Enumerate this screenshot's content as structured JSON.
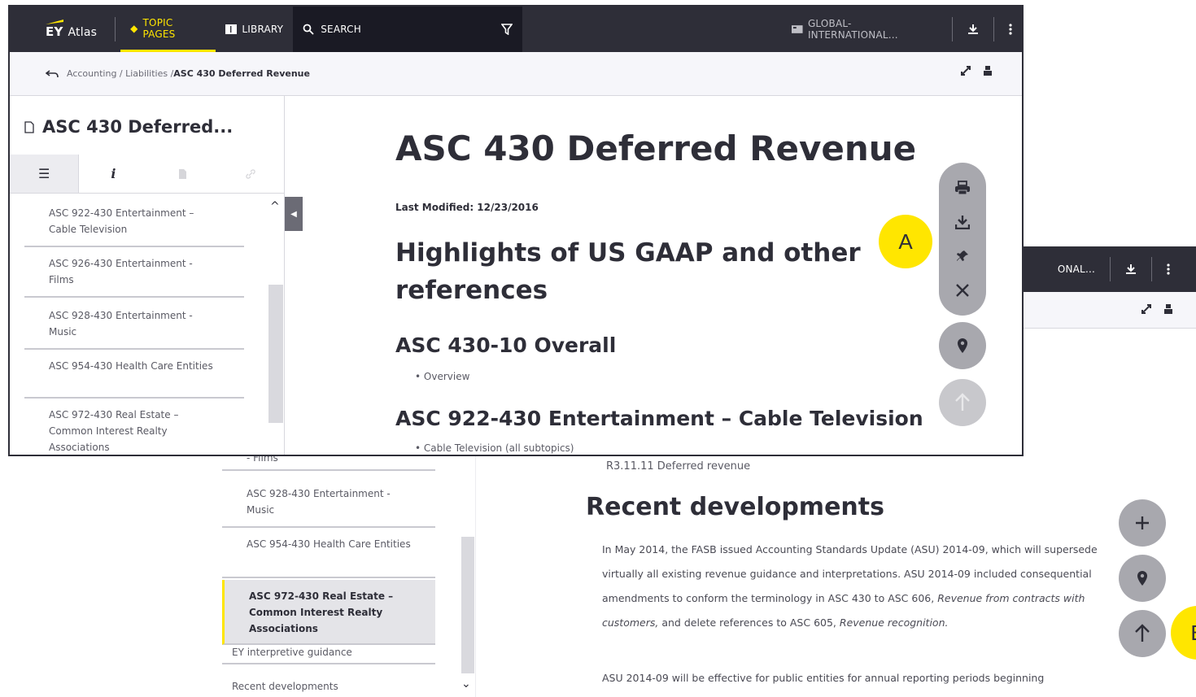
{
  "back": {
    "topbar": {
      "region": "ONAL...",
      "download_icon": "download-icon",
      "menu_icon": "more-vert-icon"
    },
    "sidebar": {
      "items": [
        {
          "label": "- Films"
        },
        {
          "label": "ASC 928-430 Entertainment - Music"
        },
        {
          "label": "ASC 954-430 Health Care Entities"
        },
        {
          "label": "ASC 972-430 Real Estate – Common Interest Realty Associations"
        },
        {
          "label": "EY interpretive guidance"
        },
        {
          "label": "Recent developments"
        }
      ]
    },
    "content": {
      "ref_item": "R3.11.11 Deferred revenue",
      "heading": "Recent developments",
      "para_1": "In May 2014, the FASB issued Accounting Standards Update (ASU) 2014-09, which will supersede virtually all existing revenue guidance and interpretations. ASU 2014-09 included consequential amendments to conform the terminology in ASC 430 to ASC 606,",
      "para_1_em": "Revenue from contracts with customers,",
      "para_1_mid": "and delete references to ASC 605,",
      "para_1_em2": "Revenue recognition.",
      "para_2": "ASU 2014-09 will be effective for public entities for annual reporting periods beginning"
    },
    "callout": "B"
  },
  "front": {
    "topbar": {
      "logo_ey": "EY",
      "logo_atlas": "Atlas",
      "topic_pages": "TOPIC PAGES",
      "library": "LIBRARY",
      "search": "SEARCH",
      "region": "GLOBAL-INTERNATIONAL..."
    },
    "breadcrumb": {
      "path": "Accounting / Liabilities / ",
      "current": "ASC 430 Deferred Revenue"
    },
    "sidebar": {
      "doc_title": "ASC 430 Deferred...",
      "tabs": [
        "☰",
        "i",
        "",
        ""
      ],
      "items": [
        {
          "label": "ASC 922-430 Entertainment – Cable Television"
        },
        {
          "label": "ASC 926-430 Entertainment - Films"
        },
        {
          "label": "ASC 928-430 Entertainment - Music"
        },
        {
          "label": "ASC 954-430 Health Care Entities"
        },
        {
          "label": "ASC 972-430 Real Estate – Common Interest Realty Associations"
        }
      ]
    },
    "content": {
      "title": "ASC 430 Deferred Revenue",
      "last_modified": "Last Modified: 12/23/2016",
      "highlights": "Highlights of US GAAP and other references",
      "sec1_title": "ASC 430-10 Overall",
      "sec1_bullet": "Overview",
      "sec2_title": "ASC 922-430 Entertainment – Cable Television",
      "sec2_bullet": "Cable Television (all subtopics)"
    },
    "callout": "A"
  },
  "colors": {
    "dark": "#2e2e38",
    "accent": "#ffe600",
    "fab": "#a8a8ae"
  }
}
